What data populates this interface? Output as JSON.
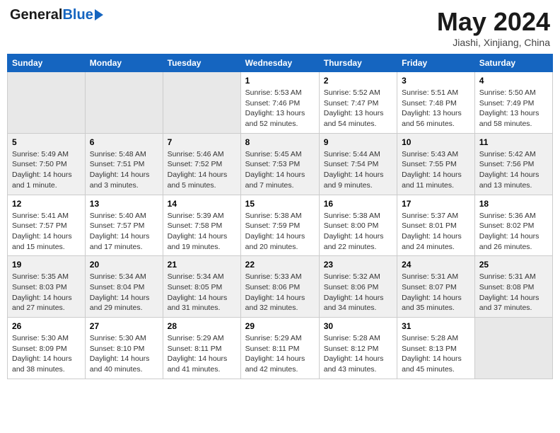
{
  "header": {
    "logo": {
      "general": "General",
      "blue": "Blue"
    },
    "title": "May 2024",
    "location": "Jiashi, Xinjiang, China"
  },
  "calendar": {
    "days_of_week": [
      "Sunday",
      "Monday",
      "Tuesday",
      "Wednesday",
      "Thursday",
      "Friday",
      "Saturday"
    ],
    "weeks": [
      [
        {
          "num": "",
          "info": ""
        },
        {
          "num": "",
          "info": ""
        },
        {
          "num": "",
          "info": ""
        },
        {
          "num": "1",
          "info": "Sunrise: 5:53 AM\nSunset: 7:46 PM\nDaylight: 13 hours\nand 52 minutes."
        },
        {
          "num": "2",
          "info": "Sunrise: 5:52 AM\nSunset: 7:47 PM\nDaylight: 13 hours\nand 54 minutes."
        },
        {
          "num": "3",
          "info": "Sunrise: 5:51 AM\nSunset: 7:48 PM\nDaylight: 13 hours\nand 56 minutes."
        },
        {
          "num": "4",
          "info": "Sunrise: 5:50 AM\nSunset: 7:49 PM\nDaylight: 13 hours\nand 58 minutes."
        }
      ],
      [
        {
          "num": "5",
          "info": "Sunrise: 5:49 AM\nSunset: 7:50 PM\nDaylight: 14 hours\nand 1 minute."
        },
        {
          "num": "6",
          "info": "Sunrise: 5:48 AM\nSunset: 7:51 PM\nDaylight: 14 hours\nand 3 minutes."
        },
        {
          "num": "7",
          "info": "Sunrise: 5:46 AM\nSunset: 7:52 PM\nDaylight: 14 hours\nand 5 minutes."
        },
        {
          "num": "8",
          "info": "Sunrise: 5:45 AM\nSunset: 7:53 PM\nDaylight: 14 hours\nand 7 minutes."
        },
        {
          "num": "9",
          "info": "Sunrise: 5:44 AM\nSunset: 7:54 PM\nDaylight: 14 hours\nand 9 minutes."
        },
        {
          "num": "10",
          "info": "Sunrise: 5:43 AM\nSunset: 7:55 PM\nDaylight: 14 hours\nand 11 minutes."
        },
        {
          "num": "11",
          "info": "Sunrise: 5:42 AM\nSunset: 7:56 PM\nDaylight: 14 hours\nand 13 minutes."
        }
      ],
      [
        {
          "num": "12",
          "info": "Sunrise: 5:41 AM\nSunset: 7:57 PM\nDaylight: 14 hours\nand 15 minutes."
        },
        {
          "num": "13",
          "info": "Sunrise: 5:40 AM\nSunset: 7:57 PM\nDaylight: 14 hours\nand 17 minutes."
        },
        {
          "num": "14",
          "info": "Sunrise: 5:39 AM\nSunset: 7:58 PM\nDaylight: 14 hours\nand 19 minutes."
        },
        {
          "num": "15",
          "info": "Sunrise: 5:38 AM\nSunset: 7:59 PM\nDaylight: 14 hours\nand 20 minutes."
        },
        {
          "num": "16",
          "info": "Sunrise: 5:38 AM\nSunset: 8:00 PM\nDaylight: 14 hours\nand 22 minutes."
        },
        {
          "num": "17",
          "info": "Sunrise: 5:37 AM\nSunset: 8:01 PM\nDaylight: 14 hours\nand 24 minutes."
        },
        {
          "num": "18",
          "info": "Sunrise: 5:36 AM\nSunset: 8:02 PM\nDaylight: 14 hours\nand 26 minutes."
        }
      ],
      [
        {
          "num": "19",
          "info": "Sunrise: 5:35 AM\nSunset: 8:03 PM\nDaylight: 14 hours\nand 27 minutes."
        },
        {
          "num": "20",
          "info": "Sunrise: 5:34 AM\nSunset: 8:04 PM\nDaylight: 14 hours\nand 29 minutes."
        },
        {
          "num": "21",
          "info": "Sunrise: 5:34 AM\nSunset: 8:05 PM\nDaylight: 14 hours\nand 31 minutes."
        },
        {
          "num": "22",
          "info": "Sunrise: 5:33 AM\nSunset: 8:06 PM\nDaylight: 14 hours\nand 32 minutes."
        },
        {
          "num": "23",
          "info": "Sunrise: 5:32 AM\nSunset: 8:06 PM\nDaylight: 14 hours\nand 34 minutes."
        },
        {
          "num": "24",
          "info": "Sunrise: 5:31 AM\nSunset: 8:07 PM\nDaylight: 14 hours\nand 35 minutes."
        },
        {
          "num": "25",
          "info": "Sunrise: 5:31 AM\nSunset: 8:08 PM\nDaylight: 14 hours\nand 37 minutes."
        }
      ],
      [
        {
          "num": "26",
          "info": "Sunrise: 5:30 AM\nSunset: 8:09 PM\nDaylight: 14 hours\nand 38 minutes."
        },
        {
          "num": "27",
          "info": "Sunrise: 5:30 AM\nSunset: 8:10 PM\nDaylight: 14 hours\nand 40 minutes."
        },
        {
          "num": "28",
          "info": "Sunrise: 5:29 AM\nSunset: 8:11 PM\nDaylight: 14 hours\nand 41 minutes."
        },
        {
          "num": "29",
          "info": "Sunrise: 5:29 AM\nSunset: 8:11 PM\nDaylight: 14 hours\nand 42 minutes."
        },
        {
          "num": "30",
          "info": "Sunrise: 5:28 AM\nSunset: 8:12 PM\nDaylight: 14 hours\nand 43 minutes."
        },
        {
          "num": "31",
          "info": "Sunrise: 5:28 AM\nSunset: 8:13 PM\nDaylight: 14 hours\nand 45 minutes."
        },
        {
          "num": "",
          "info": ""
        }
      ]
    ]
  }
}
